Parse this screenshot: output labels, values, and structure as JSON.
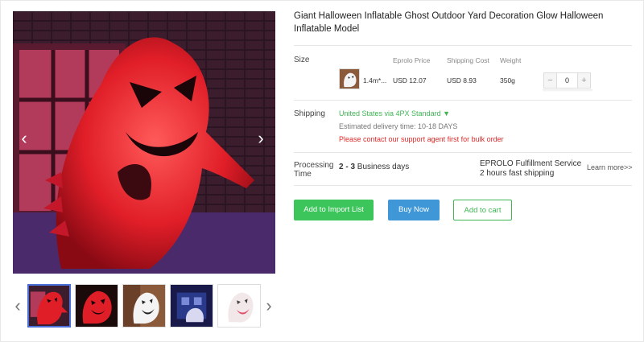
{
  "product": {
    "title": "Giant Halloween Inflatable Ghost Outdoor Yard Decoration Glow Halloween Inflatable Model"
  },
  "gallery": {
    "prev_arrow": "‹",
    "next_arrow": "›",
    "thumb_prev": "‹",
    "thumb_next": "›",
    "thumbnails": [
      {
        "name": "red-ghost-window",
        "active": true
      },
      {
        "name": "red-ghost-night",
        "active": false
      },
      {
        "name": "white-ghost-window",
        "active": false
      },
      {
        "name": "ghost-blue-house",
        "active": false
      },
      {
        "name": "white-ghost-plain",
        "active": false
      }
    ]
  },
  "size": {
    "label": "Size",
    "columns": {
      "price": "Eprolo Price",
      "shipping": "Shipping Cost",
      "weight": "Weight"
    },
    "variant": {
      "name": "1.4m*...",
      "price": "USD 12.07",
      "shipping": "USD 8.93",
      "weight": "350g",
      "quantity": "0",
      "minus": "−",
      "plus": "+"
    }
  },
  "shipping": {
    "label": "Shipping",
    "method": "United States via 4PX Standard ▼",
    "estimated": "Estimated delivery time: 10-18 DAYS",
    "warning": "Please contact our support agent first for bulk order"
  },
  "processing": {
    "label_line1": "Processing",
    "label_line2": "Time",
    "days_bold": "2 - 3",
    "days_rest": " Business days",
    "service_line1": "EPROLO Fulfillment Service",
    "service_line2": "2 hours fast shipping",
    "learn_more": "Learn more>>"
  },
  "actions": {
    "import": "Add to Import List",
    "buy": "Buy Now",
    "cart": "Add to cart"
  },
  "colors": {
    "accent_green": "#3cc55a",
    "accent_blue": "#3f97d8",
    "warning_red": "#e02a2a"
  }
}
